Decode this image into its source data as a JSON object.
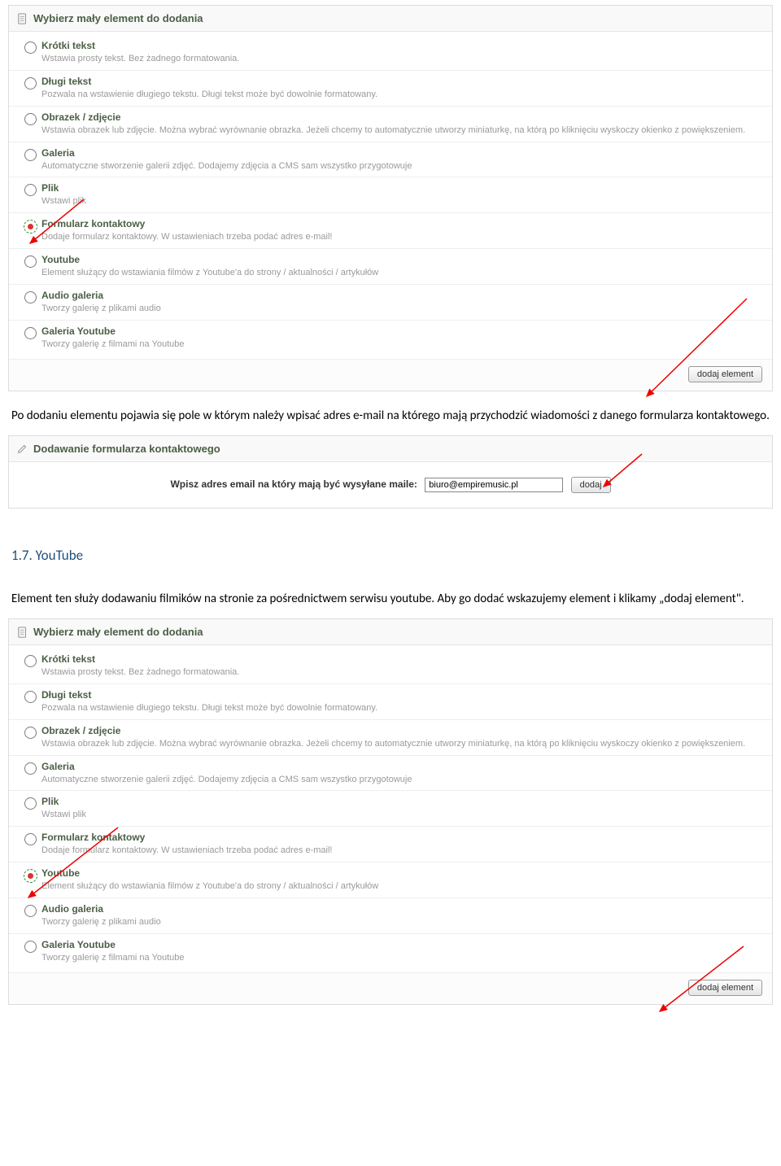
{
  "panel1": {
    "title": "Wybierz mały element do dodania",
    "items": [
      {
        "title": "Krótki tekst",
        "desc": "Wstawia prosty tekst. Bez żadnego formatowania."
      },
      {
        "title": "Długi tekst",
        "desc": "Pozwala na wstawienie długiego tekstu. Długi tekst może być dowolnie formatowany."
      },
      {
        "title": "Obrazek / zdjęcie",
        "desc": "Wstawia obrazek lub zdjęcie. Można wybrać wyrównanie obrazka. Jeżeli chcemy to automatycznie utworzy miniaturkę, na którą po kliknięciu wyskoczy okienko z powiększeniem."
      },
      {
        "title": "Galeria",
        "desc": "Automatyczne stworzenie galerii zdjęć. Dodajemy zdjęcia a CMS sam wszystko przygotowuje"
      },
      {
        "title": "Plik",
        "desc": "Wstawi plik"
      },
      {
        "title": "Formularz kontaktowy",
        "desc": "Dodaje formularz kontaktowy. W ustawieniach trzeba podać adres e-mail!"
      },
      {
        "title": "Youtube",
        "desc": "Element służący do wstawiania filmów z Youtube'a do strony / aktualności / artykułów"
      },
      {
        "title": "Audio galeria",
        "desc": "Tworzy galerię z plikami audio"
      },
      {
        "title": "Galeria Youtube",
        "desc": "Tworzy galerię z filmami na Youtube"
      }
    ],
    "selected_index": 5,
    "footer_button": "dodaj element"
  },
  "docText1": "Po dodaniu elementu pojawia się pole w którym należy wpisać adres e-mail na którego mają przychodzić wiadomości z danego formularza kontaktowego.",
  "emailPanel": {
    "title": "Dodawanie formularza kontaktowego",
    "label": "Wpisz adres email na który mają być wysyłane maile:",
    "value": "biuro@empiremusic.pl",
    "button": "dodaj"
  },
  "sectionHeading": "1.7. YouTube",
  "docText2": "Element ten służy dodawaniu filmików na stronie za pośrednictwem serwisu youtube. Aby go dodać wskazujemy element i klikamy „dodaj element\".",
  "panel2": {
    "title": "Wybierz mały element do dodania",
    "items": [
      {
        "title": "Krótki tekst",
        "desc": "Wstawia prosty tekst. Bez żadnego formatowania."
      },
      {
        "title": "Długi tekst",
        "desc": "Pozwala na wstawienie długiego tekstu. Długi tekst może być dowolnie formatowany."
      },
      {
        "title": "Obrazek / zdjęcie",
        "desc": "Wstawia obrazek lub zdjęcie. Można wybrać wyrównanie obrazka. Jeżeli chcemy to automatycznie utworzy miniaturkę, na którą po kliknięciu wyskoczy okienko z powiększeniem."
      },
      {
        "title": "Galeria",
        "desc": "Automatyczne stworzenie galerii zdjęć. Dodajemy zdjęcia a CMS sam wszystko przygotowuje"
      },
      {
        "title": "Plik",
        "desc": "Wstawi plik"
      },
      {
        "title": "Formularz kontaktowy",
        "desc": "Dodaje formularz kontaktowy. W ustawieniach trzeba podać adres e-mail!"
      },
      {
        "title": "Youtube",
        "desc": "Element służący do wstawiania filmów z Youtube'a do strony / aktualności / artykułów"
      },
      {
        "title": "Audio galeria",
        "desc": "Tworzy galerię z plikami audio"
      },
      {
        "title": "Galeria Youtube",
        "desc": "Tworzy galerię z filmami na Youtube"
      }
    ],
    "selected_index": 6,
    "footer_button": "dodaj element"
  }
}
